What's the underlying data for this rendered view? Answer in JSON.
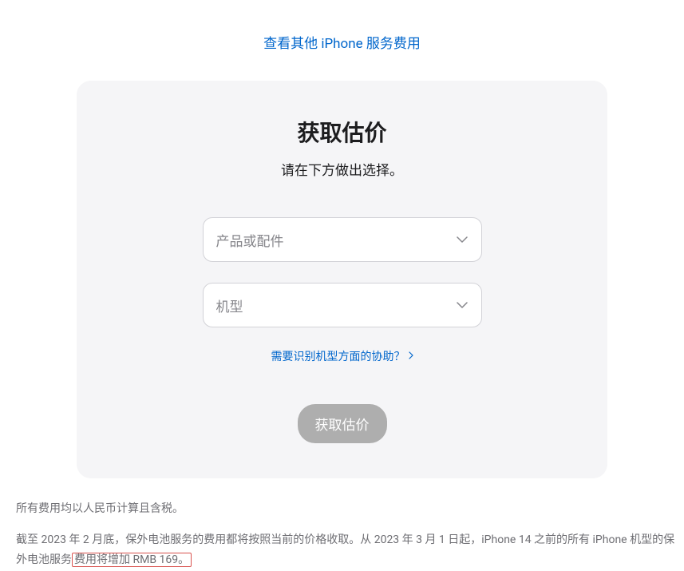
{
  "topLink": "查看其他 iPhone 服务费用",
  "card": {
    "title": "获取估价",
    "subtitle": "请在下方做出选择。",
    "select1Placeholder": "产品或配件",
    "select2Placeholder": "机型",
    "helpLink": "需要识别机型方面的协助？",
    "submitButton": "获取估价"
  },
  "footer": {
    "line1": "所有费用均以人民币计算且含税。",
    "line2_part1": "截至 2023 年 2 月底，保外电池服务的费用都将按照当前的价格收取。从 2023 年 3 月 1 日起，iPhone 14 之前的所有 iPhone 机型的保外电池服务",
    "line2_highlight": "费用将增加 RMB 169。"
  }
}
